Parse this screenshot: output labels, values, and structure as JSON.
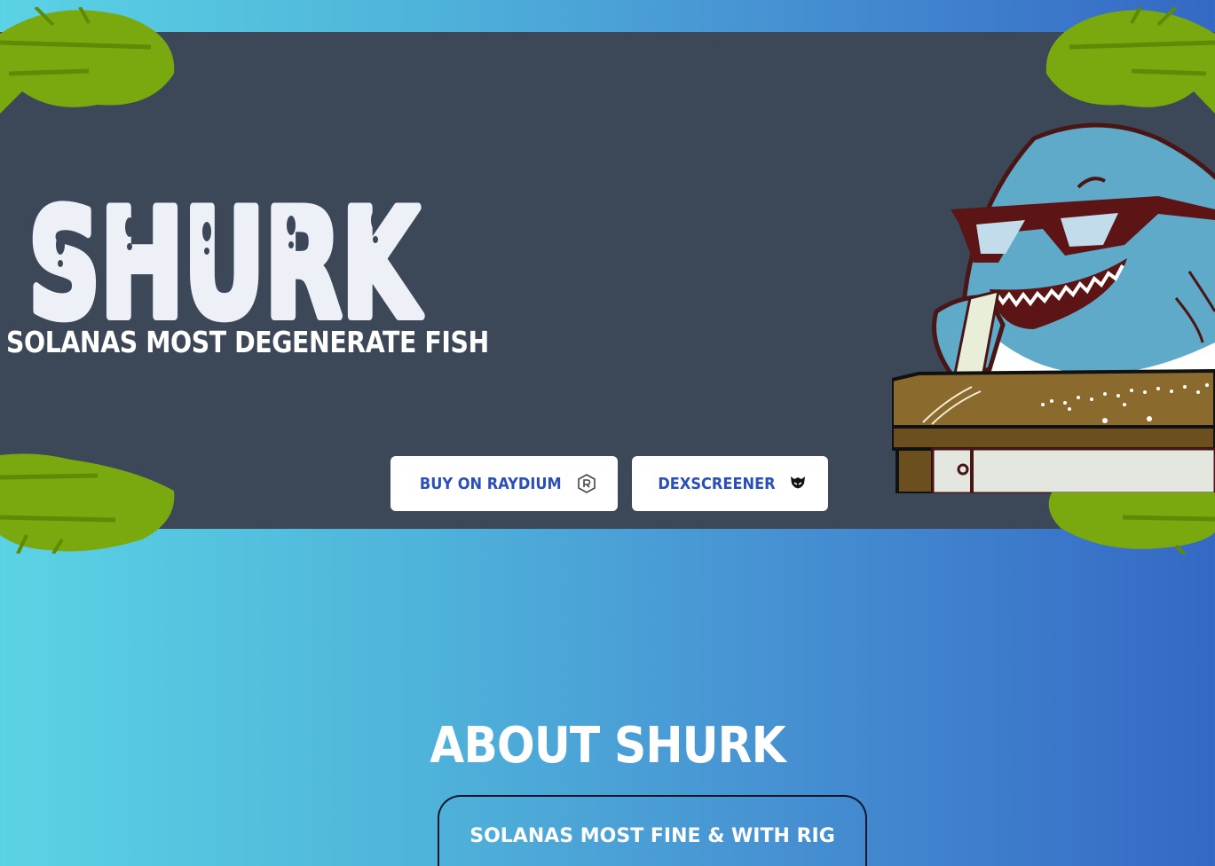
{
  "hero": {
    "logo_text": "SHURK",
    "tagline": "SOLANAS MOST DEGENERATE FISH",
    "buttons": {
      "raydium_label": "BUY ON RAYDIUM",
      "dexscreener_label": "DEXSCREENER"
    }
  },
  "about": {
    "title": "ABOUT SHURK",
    "text_partial": "SOLANAS MOST FINE & WITH RIG"
  },
  "colors": {
    "hero_bg": "#3c4858",
    "button_text": "#2b4fb8",
    "leaf": "#7aa80f",
    "page_gradient_start": "#5ad3e4",
    "page_gradient_end": "#3468c4"
  },
  "icons": {
    "raydium": "raydium-icon",
    "dexscreener": "dexscreener-icon",
    "leaf": "palm-leaf-icon",
    "mascot": "shark-mascot"
  }
}
